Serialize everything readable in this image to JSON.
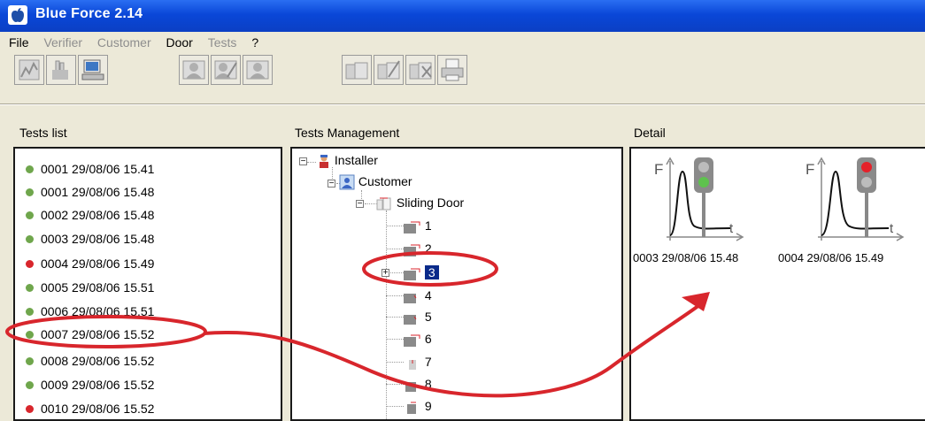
{
  "window": {
    "title": "Blue Force 2.14",
    "app_icon": "apple-logo-icon"
  },
  "menu": [
    {
      "label": "File",
      "enabled": true
    },
    {
      "label": "Verifier",
      "enabled": false
    },
    {
      "label": "Customer",
      "enabled": false
    },
    {
      "label": "Door",
      "enabled": true
    },
    {
      "label": "Tests",
      "enabled": false
    },
    {
      "label": "?",
      "enabled": true
    }
  ],
  "toolbar": {
    "icons": [
      "curve-icon",
      "glove-icon",
      "computer-icon",
      "user-icon",
      "user-edit-icon",
      "user-delete-icon",
      "door-icon",
      "door-edit-icon",
      "door-delete-icon",
      "printer-icon"
    ]
  },
  "panels": {
    "tests_list_label": "Tests list",
    "management_label": "Tests Management",
    "detail_label": "Detail"
  },
  "tests": [
    {
      "label": "0001 29/08/06 15.41",
      "status": "pass"
    },
    {
      "label": "0001 29/08/06 15.48",
      "status": "pass"
    },
    {
      "label": "0002 29/08/06 15.48",
      "status": "pass"
    },
    {
      "label": "0003 29/08/06 15.48",
      "status": "pass"
    },
    {
      "label": "0004 29/08/06 15.49",
      "status": "fail"
    },
    {
      "label": "0005 29/08/06 15.51",
      "status": "pass"
    },
    {
      "label": "0006 29/08/06 15.51",
      "status": "pass"
    },
    {
      "label": "0007 29/08/06 15.52",
      "status": "pass"
    },
    {
      "label": "0008 29/08/06 15.52",
      "status": "pass"
    },
    {
      "label": "0009 29/08/06 15.52",
      "status": "pass"
    },
    {
      "label": "0010 29/08/06 15.52",
      "status": "fail"
    }
  ],
  "tree": {
    "installer": "Installer",
    "customer": "Customer",
    "sliding_door": "Sliding Door",
    "tests": [
      "1",
      "2",
      "3",
      "4",
      "5",
      "6",
      "7",
      "8",
      "9"
    ],
    "selected": "3"
  },
  "detail": {
    "items": [
      {
        "label": "0003 29/08/06 15.48",
        "light": "green",
        "f_label": "F",
        "t_label": "t"
      },
      {
        "label": "0004 29/08/06 15.49",
        "light": "red",
        "f_label": "F",
        "t_label": "t"
      }
    ]
  },
  "colors": {
    "pass": "#6fa64c",
    "fail": "#d8262c",
    "annotation": "#d8262c",
    "selection": "#0a2a8a",
    "title_bar": "#0a47d8"
  }
}
